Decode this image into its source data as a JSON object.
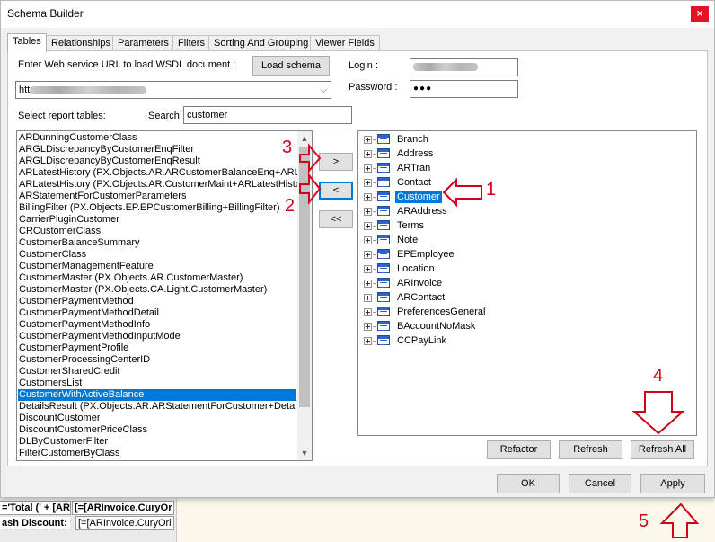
{
  "window": {
    "title": "Schema Builder",
    "close_glyph": "×"
  },
  "tabs": [
    {
      "label": "Tables",
      "active": true
    },
    {
      "label": "Relationships"
    },
    {
      "label": "Parameters"
    },
    {
      "label": "Filters"
    },
    {
      "label": "Sorting And Grouping"
    },
    {
      "label": "Viewer Fields"
    }
  ],
  "wsdl": {
    "label": "Enter Web service URL to load WSDL document :",
    "load_button": "Load schema",
    "url_value_prefix": "htt",
    "url_value_blurred": true
  },
  "auth": {
    "login_label": "Login :",
    "login_value_blurred": true,
    "password_label": "Password :",
    "password_value": "●●●"
  },
  "report_tables": {
    "label": "Select report tables:",
    "search_label": "Search:",
    "search_value": "customer",
    "items": [
      "ARDunningCustomerClass",
      "ARGLDiscrepancyByCustomerEnqFilter",
      "ARGLDiscrepancyByCustomerEnqResult",
      "ARLatestHistory (PX.Objects.AR.ARCustomerBalanceEnq+ARLat",
      "ARLatestHistory (PX.Objects.AR.CustomerMaint+ARLatestHistor",
      "ARStatementForCustomerParameters",
      "BillingFilter (PX.Objects.EP.EPCustomerBilling+BillingFilter)",
      "CarrierPluginCustomer",
      "CRCustomerClass",
      "CustomerBalanceSummary",
      "CustomerClass",
      "CustomerManagementFeature",
      "CustomerMaster (PX.Objects.AR.CustomerMaster)",
      "CustomerMaster (PX.Objects.CA.Light.CustomerMaster)",
      "CustomerPaymentMethod",
      "CustomerPaymentMethodDetail",
      "CustomerPaymentMethodInfo",
      "CustomerPaymentMethodInputMode",
      "CustomerPaymentProfile",
      "CustomerProcessingCenterID",
      "CustomerSharedCredit",
      "CustomersList",
      "CustomerWithActiveBalance",
      "DetailsResult (PX.Objects.AR.ARStatementForCustomer+DetailsR",
      "DiscountCustomer",
      "DiscountCustomerPriceClass",
      "DLByCustomerFilter",
      "FilterCustomerByClass"
    ],
    "selected_index": 22
  },
  "transfer_buttons": {
    "add": ">",
    "remove": "<",
    "remove_all": "<<"
  },
  "selected_tables": {
    "items": [
      "Branch",
      "Address",
      "ARTran",
      "Contact",
      "Customer",
      "ARAddress",
      "Terms",
      "Note",
      "EPEmployee",
      "Location",
      "ARInvoice",
      "ARContact",
      "PreferencesGeneral",
      "BAccountNoMask",
      "CCPayLink"
    ],
    "selected_index": 4
  },
  "tree_buttons": {
    "refactor": "Refactor",
    "refresh": "Refresh",
    "refresh_all": "Refresh All"
  },
  "footer_buttons": {
    "ok": "OK",
    "cancel": "Cancel",
    "apply": "Apply"
  },
  "background": {
    "row1_a": "='Total (' + [ARI",
    "row1_b": "[=[ARInvoice.CuryOr",
    "row2_a": "ash Discount:",
    "row2_b": "[=[ARInvoice.CuryOri"
  },
  "annotations": {
    "n1": "1",
    "n2": "2",
    "n3": "3",
    "n4": "4",
    "n5": "5",
    "color": "#d0021b"
  }
}
